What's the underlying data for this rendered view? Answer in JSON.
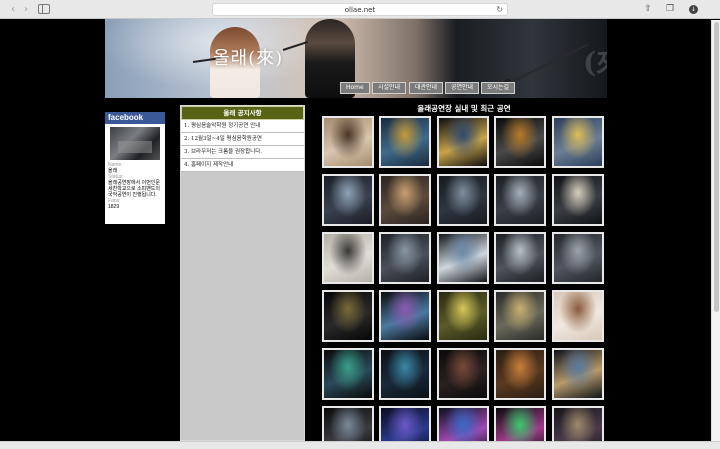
{
  "browser": {
    "url": "ollae.net"
  },
  "banner": {
    "title": "올래(來)",
    "sign": "(來)"
  },
  "menu": [
    {
      "label": "Home"
    },
    {
      "label": "시설안내"
    },
    {
      "label": "대관안내"
    },
    {
      "label": "공연안내"
    },
    {
      "label": "오시는길"
    }
  ],
  "facebook": {
    "brand": "facebook",
    "name_label": "Name:",
    "name": "올래",
    "status_label": "Status:",
    "status": "올래공연장에서 이번인문세찬학교으로 소피밴드의 국악공연이 진행됩니다.",
    "fans_label": "Fans:",
    "fans": "1829"
  },
  "notice": {
    "title": "올래 공지사항",
    "items": [
      {
        "label": "1. 평심음술악학원 정기공연 안내"
      },
      {
        "label": "2. 12월3일~4일 평심음학원공연"
      },
      {
        "label": "3. 브라우저는 크롬을 권장합니다."
      },
      {
        "label": "4. 홈페이지 제작안내"
      }
    ]
  },
  "gallery": {
    "title": "올래공연장 실내 및 최근 공연",
    "thumbnails": [
      {
        "colors": [
          "#a58d6f",
          "#4a3526",
          "#d8c6ae"
        ]
      },
      {
        "colors": [
          "#1b2a3e",
          "#c79a3a",
          "#3e6a8a"
        ]
      },
      {
        "colors": [
          "#0c0c0e",
          "#2e4a72",
          "#c7a44a"
        ]
      },
      {
        "colors": [
          "#0a0a0a",
          "#b87b2a",
          "#4a4a4a"
        ]
      },
      {
        "colors": [
          "#2c3e5a",
          "#dcbe58",
          "#6b7e95"
        ]
      },
      {
        "colors": [
          "#1a1d24",
          "#8ea4b8",
          "#3a4150"
        ]
      },
      {
        "colors": [
          "#2a2420",
          "#c8a070",
          "#5a4a3c"
        ]
      },
      {
        "colors": [
          "#16191e",
          "#7e8fa0",
          "#2f3640"
        ]
      },
      {
        "colors": [
          "#1c1f24",
          "#a6b0ba",
          "#3a4048"
        ]
      },
      {
        "colors": [
          "#101215",
          "#d8d0c0",
          "#3a3e44"
        ]
      },
      {
        "colors": [
          "#b5b1a8",
          "#3a3834",
          "#e0ddd6"
        ]
      },
      {
        "colors": [
          "#1e2024",
          "#8a96a4",
          "#4a505a"
        ]
      },
      {
        "colors": [
          "#13171c",
          "#6b8aa8",
          "#cfd6dc"
        ]
      },
      {
        "colors": [
          "#1c1e22",
          "#b8c0c8",
          "#4e545c"
        ]
      },
      {
        "colors": [
          "#24262a",
          "#9ca4ac",
          "#505660"
        ]
      },
      {
        "colors": [
          "#050505",
          "#7a6a3a",
          "#2a2a2a"
        ]
      },
      {
        "colors": [
          "#0a0a0c",
          "#8a5ab0",
          "#4a7aa0"
        ]
      },
      {
        "colors": [
          "#2a2a10",
          "#d6c85a",
          "#5a5a2a"
        ]
      },
      {
        "colors": [
          "#2a2a2a",
          "#c8b070",
          "#6a6a5a"
        ]
      },
      {
        "colors": [
          "#d8c8b8",
          "#8a5a3a",
          "#f0e8e0"
        ]
      },
      {
        "colors": [
          "#0a0a0a",
          "#3aa08a",
          "#2a4a5a"
        ]
      },
      {
        "colors": [
          "#0c0f14",
          "#3a8aa8",
          "#1a2a3a"
        ]
      },
      {
        "colors": [
          "#0a0a0a",
          "#7a4a3a",
          "#2a2020"
        ]
      },
      {
        "colors": [
          "#2a1c12",
          "#c8803a",
          "#5a3a20"
        ]
      },
      {
        "colors": [
          "#0e1218",
          "#5a7aa0",
          "#b89a6a"
        ]
      },
      {
        "colors": [
          "#0a0a0a",
          "#7a8a9a",
          "#3a3a40"
        ]
      },
      {
        "colors": [
          "#0a0a20",
          "#6a5ac8",
          "#2a3a8a"
        ]
      },
      {
        "colors": [
          "#0a1020",
          "#3a6ac8",
          "#a04ab0"
        ]
      },
      {
        "colors": [
          "#0a0a0a",
          "#3ac86a",
          "#a03a8a"
        ]
      },
      {
        "colors": [
          "#14141a",
          "#a08a6a",
          "#4a3a4a"
        ]
      }
    ]
  }
}
